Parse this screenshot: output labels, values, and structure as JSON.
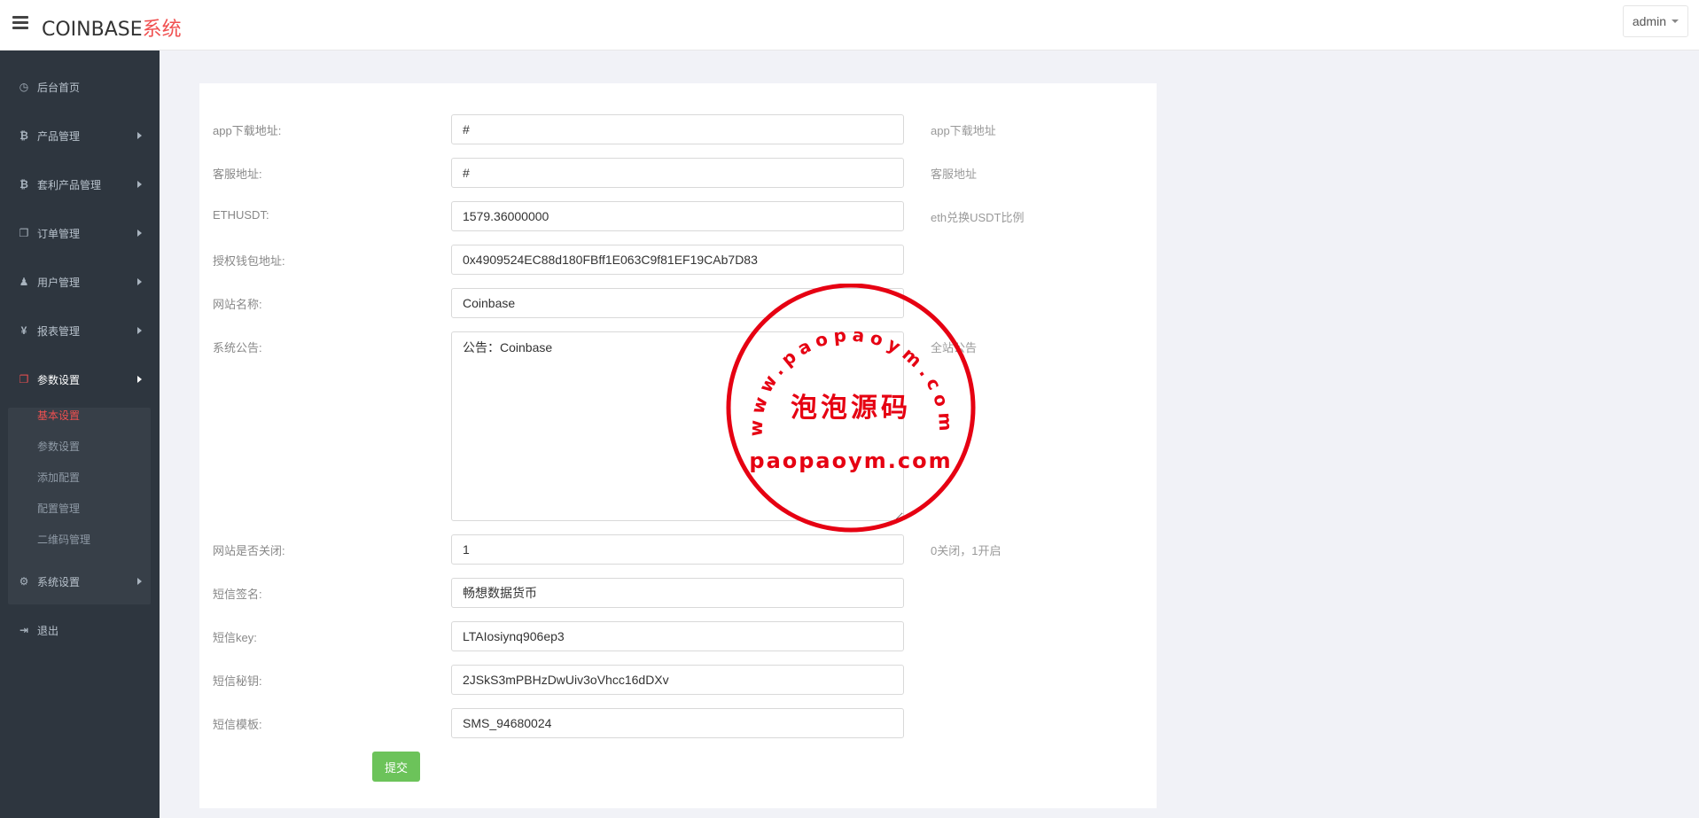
{
  "header": {
    "logo_main": "COINBASE",
    "logo_accent": "系统",
    "user": "admin"
  },
  "sidebar": {
    "items": [
      {
        "label": "后台首页",
        "icon": "dashboard-icon",
        "glyph": "◷"
      },
      {
        "label": "产品管理",
        "icon": "bitcoin-icon",
        "glyph": "₿"
      },
      {
        "label": "套利产品管理",
        "icon": "bitcoin-icon",
        "glyph": "₿"
      },
      {
        "label": "订单管理",
        "icon": "copy-icon",
        "glyph": "❐"
      },
      {
        "label": "用户管理",
        "icon": "user-icon",
        "glyph": "♟"
      },
      {
        "label": "报表管理",
        "icon": "yen-icon",
        "glyph": "¥"
      },
      {
        "label": "参数设置",
        "icon": "settings-copy-icon",
        "glyph": "❐"
      },
      {
        "label": "系统设置",
        "icon": "cogs-icon",
        "glyph": "⚙"
      },
      {
        "label": "退出",
        "icon": "sign-out-icon",
        "glyph": "⇥"
      }
    ],
    "sub_items": [
      "基本设置",
      "参数设置",
      "添加配置",
      "配置管理",
      "二维码管理"
    ]
  },
  "form": {
    "rows": [
      {
        "label": "app下载地址:",
        "value": "#",
        "hint": "app下载地址"
      },
      {
        "label": "客服地址:",
        "value": "#",
        "hint": "客服地址"
      },
      {
        "label": "ETHUSDT:",
        "value": "1579.36000000",
        "hint": "eth兑换USDT比例"
      },
      {
        "label": "授权钱包地址:",
        "value": "0x4909524EC88d180FBff1E063C9f81EF19CAb7D83",
        "hint": ""
      },
      {
        "label": "网站名称:",
        "value": "Coinbase",
        "hint": ""
      },
      {
        "label": "系统公告:",
        "value": "公告：Coinbase",
        "hint": "全站公告"
      },
      {
        "label": "网站是否关闭:",
        "value": "1",
        "hint": "0关闭，1开启"
      },
      {
        "label": "短信签名:",
        "value": "畅想数据货币",
        "hint": ""
      },
      {
        "label": "短信key:",
        "value": "LTAIosiynq906ep3",
        "hint": ""
      },
      {
        "label": "短信秘钥:",
        "value": "2JSkS3mPBHzDwUiv3oVhcc16dDXv",
        "hint": ""
      },
      {
        "label": "短信模板:",
        "value": "SMS_94680024",
        "hint": ""
      }
    ],
    "submit_label": "提交"
  },
  "watermark": {
    "arc_text": "www.paopaoym.com",
    "center_text": "泡泡源码",
    "bottom_text": "paopaoym.com",
    "color": "#e60012"
  }
}
